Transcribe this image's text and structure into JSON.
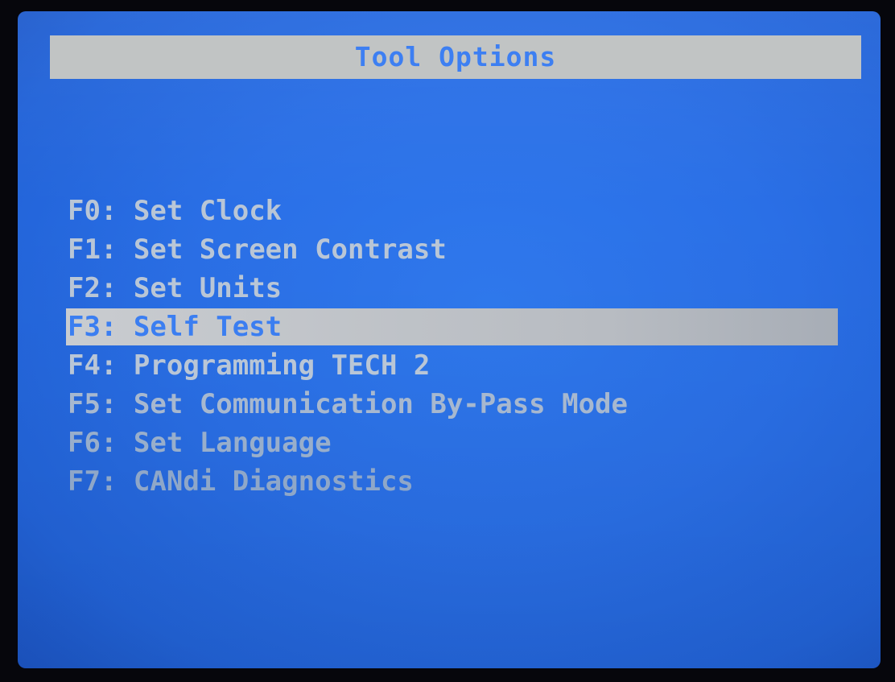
{
  "screen": {
    "title": "Tool Options",
    "selected_index": 3
  },
  "menu": {
    "items": [
      {
        "key": "F0:",
        "label": "Set Clock"
      },
      {
        "key": "F1:",
        "label": "Set Screen Contrast"
      },
      {
        "key": "F2:",
        "label": "Set Units"
      },
      {
        "key": "F3:",
        "label": "Self Test"
      },
      {
        "key": "F4:",
        "label": "Programming TECH 2"
      },
      {
        "key": "F5:",
        "label": "Set Communication By-Pass Mode"
      },
      {
        "key": "F6:",
        "label": "Set Language"
      },
      {
        "key": "F7:",
        "label": "CANdi Diagnostics"
      }
    ]
  },
  "colors": {
    "lcd_background": "#2a6fe6",
    "title_bar": "#c1c4c4",
    "title_text": "#3d7ff2",
    "menu_text": "#b9c6d6",
    "highlight_bar": "#c1c4c8",
    "highlight_text": "#3b7ef1"
  }
}
